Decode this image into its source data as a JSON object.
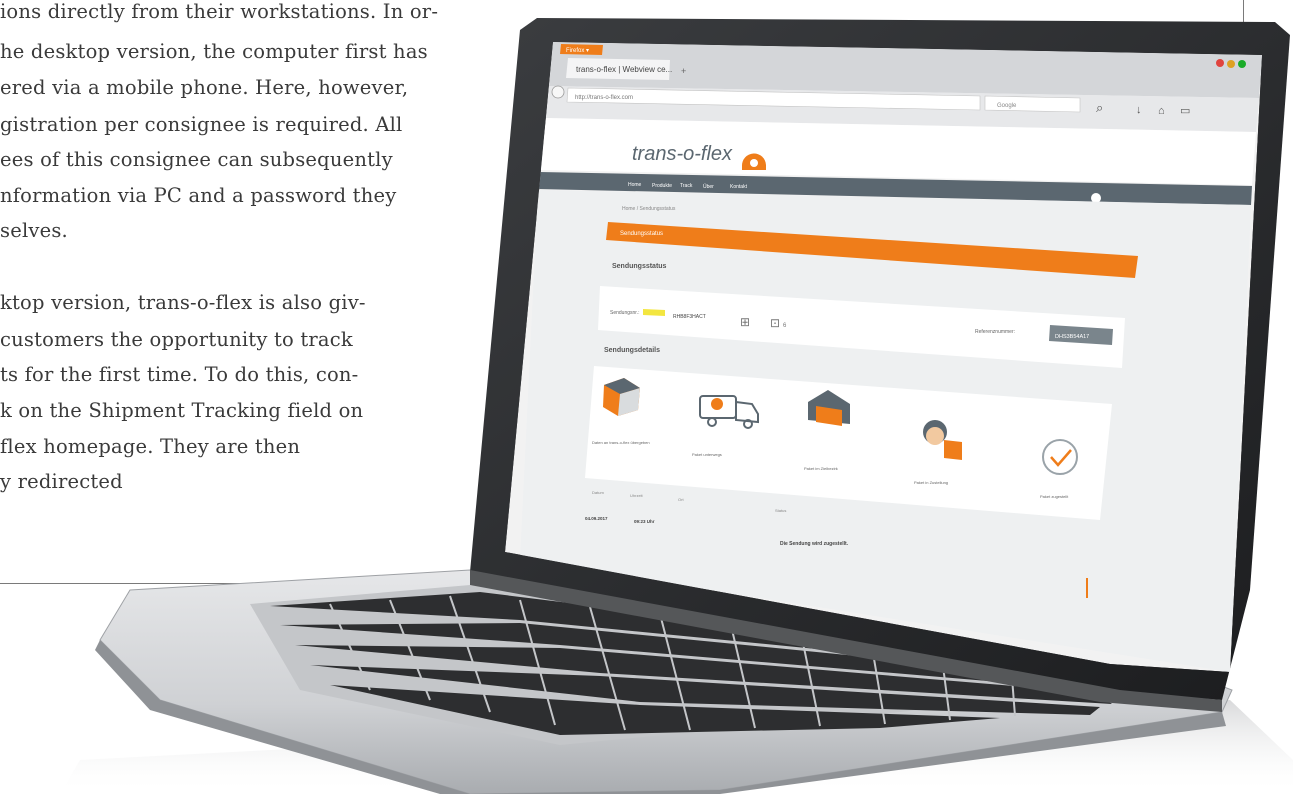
{
  "article": {
    "lines": [
      "ions directly from their workstations. In or-",
      "he desktop version, the computer first has",
      "ered via a mobile phone. Here, however,",
      "gistration per consignee is required. All",
      "ees of this consignee can subsequently",
      "nformation via PC and a password they",
      "selves.",
      "",
      "ktop version, trans-o-flex is also giv-",
      "customers the opportunity to track",
      "ts for the first time. To do this, con-",
      "k on the Shipment Tracking field on",
      "flex homepage. They are then",
      "y     redirected"
    ]
  },
  "browser": {
    "menu_button": "Firefox ▾",
    "tab_title": "trans-o-flex | Webview ce...",
    "new_tab": "+",
    "address": "http://trans-o-flex.com",
    "search_placeholder": "Google",
    "colors": {
      "accent": "#ef7d1a",
      "nav": "#5b6770"
    }
  },
  "site": {
    "logo_text": "trans-o-flex",
    "nav_items": [
      "Home",
      "Produkte",
      "Track",
      "Über",
      "Kontakt"
    ],
    "breadcrumb": "Home / Sendungsstatus",
    "banner": "Sendungsstatus",
    "section_title": "Sendungsstatus",
    "shipment_label": "Sendungsnr.:",
    "shipment_value": "RHB8F3HACT",
    "badge_value": "6",
    "status_label": "Referenznummer:",
    "status_value": "DHS3B54A17",
    "steps_title": "Sendungsdetails",
    "steps": [
      {
        "icon": "box-icon",
        "label": "Daten an trans-o-flex übergeben"
      },
      {
        "icon": "truck-icon",
        "label": "Paket unterwegs"
      },
      {
        "icon": "depot-icon",
        "label": "Paket im Zielbezirk"
      },
      {
        "icon": "courier-icon",
        "label": "Paket in Zustellung"
      },
      {
        "icon": "check-icon",
        "label": "Paket zugestellt"
      }
    ],
    "table_headers": [
      "Datum",
      "Uhrzeit",
      "Ort",
      "Status"
    ],
    "row_date": "04.09.2017",
    "row_time": "09:23 Uhr",
    "row_status": "Die Sendung wird zugestellt."
  }
}
